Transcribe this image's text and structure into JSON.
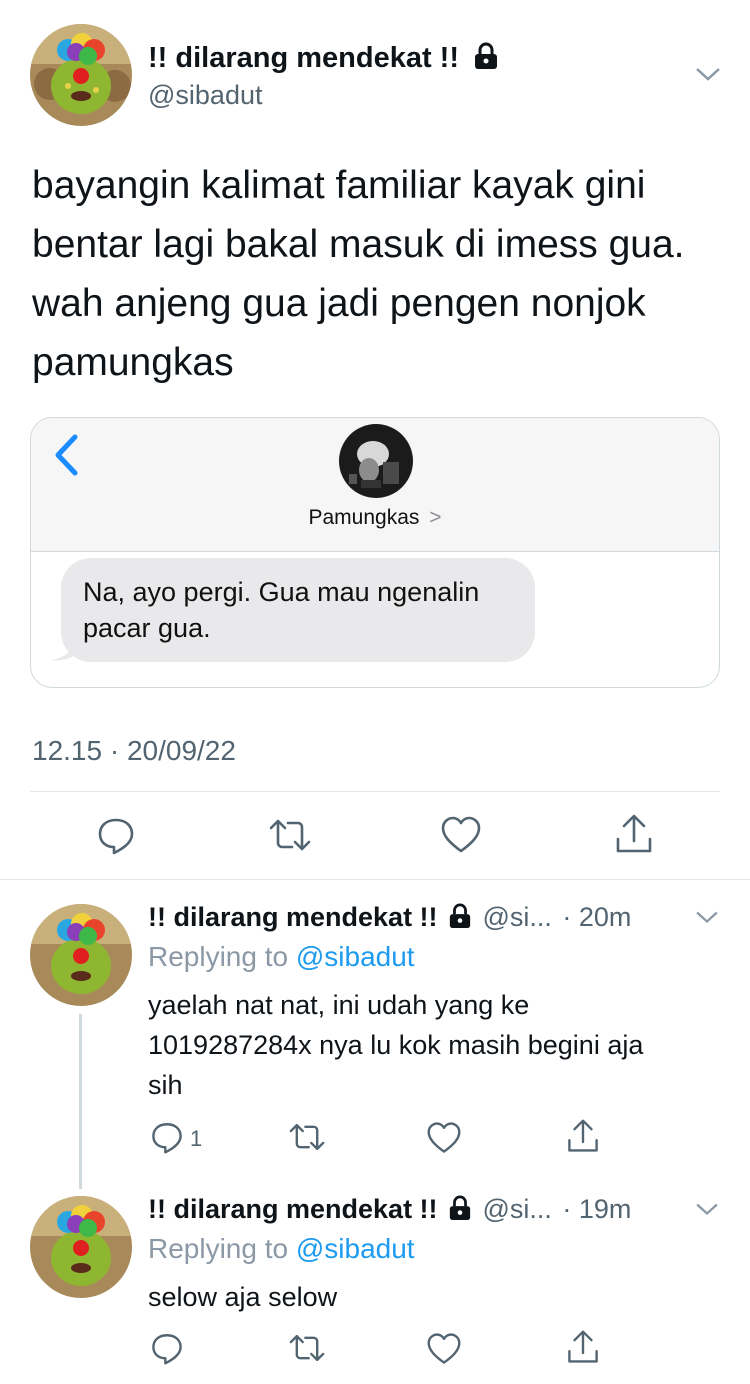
{
  "tweet": {
    "display_name": "!! dilarang mendekat !!",
    "handle": "@sibadut",
    "lines": [
      "bayangin kalimat familiar kayak gini",
      "bentar lagi bakal masuk di imess gua.",
      "wah anjeng gua jadi pengen nonjok",
      "pamungkas"
    ],
    "timestamp": "12.15 · 20/09/22"
  },
  "imessage": {
    "contact_name": "Pamungkas",
    "contact_chevron": ">",
    "message_lines": [
      "Na, ayo pergi. Gua mau ngenalin",
      "pacar gua."
    ]
  },
  "replies": [
    {
      "display_name": "!! dilarang mendekat !!",
      "handle_truncated": "@si...",
      "time": "· 20m",
      "replying_prefix": "Replying to",
      "replying_handle": "@sibadut",
      "lines": [
        "yaelah nat nat, ini udah yang ke",
        "1019287284x nya lu kok masih begini aja",
        "sih"
      ],
      "reply_count": "1"
    },
    {
      "display_name": "!! dilarang mendekat !!",
      "handle_truncated": "@si...",
      "time": "· 19m",
      "replying_prefix": "Replying to",
      "replying_handle": "@sibadut",
      "lines": [
        "selow aja selow"
      ],
      "reply_count": ""
    }
  ],
  "icons": {
    "reply": "speech-bubble",
    "retweet": "retweet-arrows",
    "like": "heart",
    "share": "share-upload",
    "lock": "padlock",
    "chevron": "chevron-down",
    "back": "chevron-left"
  },
  "colors": {
    "link_blue": "#1d9bf0",
    "ios_blue": "#1a8cff",
    "muted": "#536471"
  }
}
